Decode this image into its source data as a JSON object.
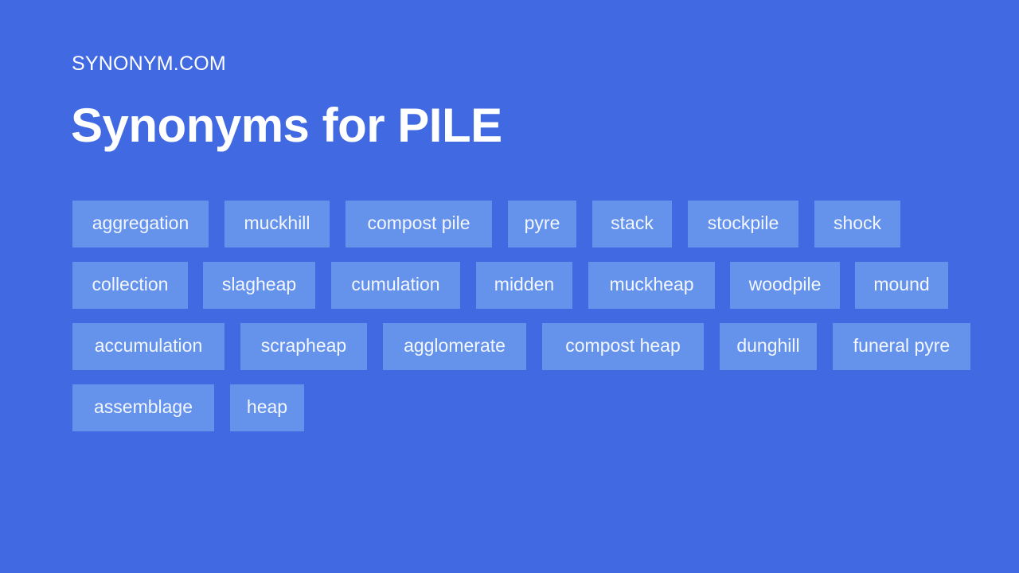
{
  "brand": "SYNONYM.COM",
  "title": "Synonyms for PILE",
  "colors": {
    "background": "#4169e1",
    "chip": "#6592ea",
    "text": "#ffffff"
  },
  "synonym_rows": [
    [
      "aggregation",
      "muckhill",
      "compost pile",
      "pyre",
      "stack",
      "stockpile",
      "shock"
    ],
    [
      "collection",
      "slagheap",
      "cumulation",
      "midden",
      "muckheap",
      "woodpile",
      "mound"
    ],
    [
      "accumulation",
      "scrapheap",
      "agglomerate",
      "compost heap",
      "dunghill",
      "funeral pyre"
    ],
    [
      "assemblage",
      "heap"
    ]
  ]
}
